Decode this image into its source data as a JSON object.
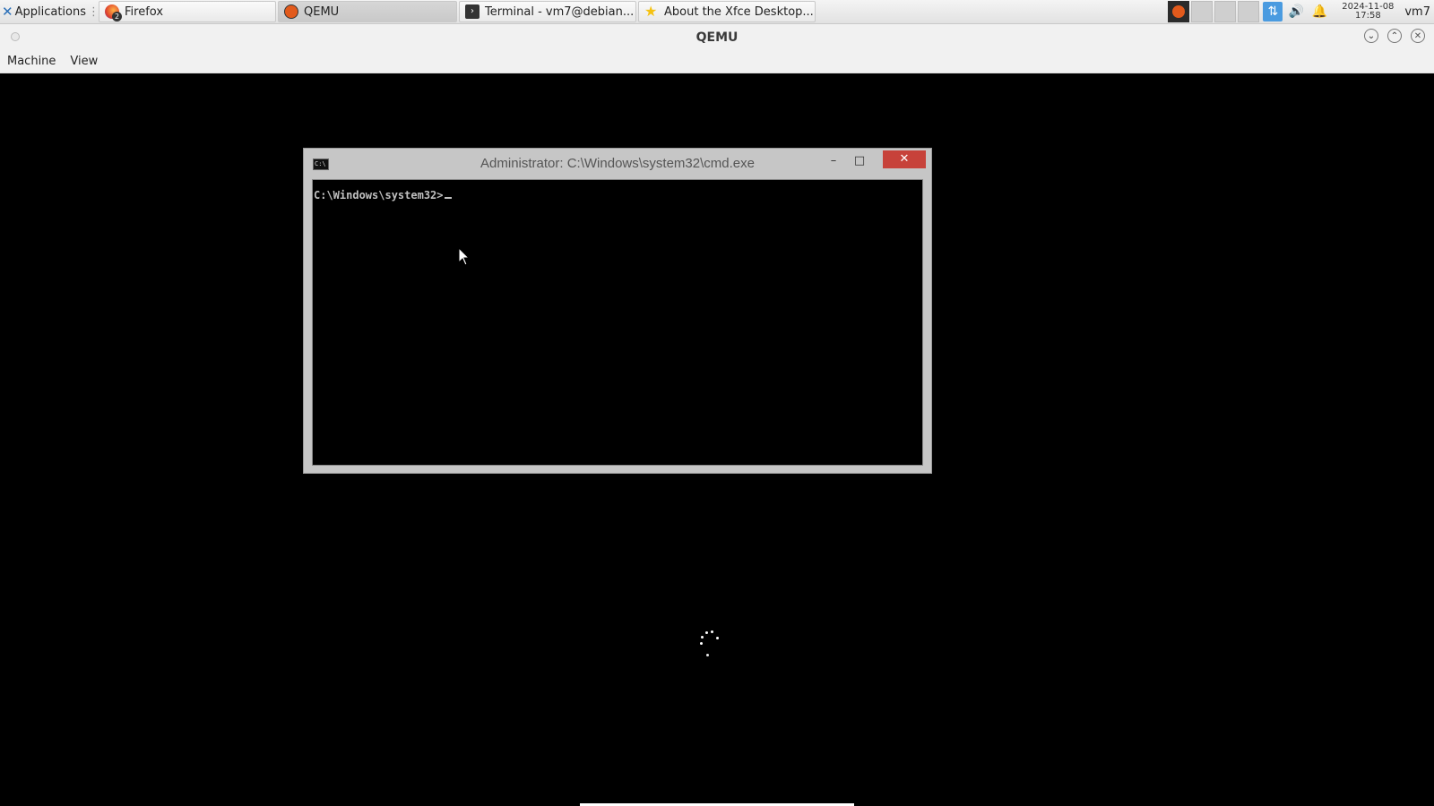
{
  "panel": {
    "app_menu_label": "Applications",
    "tasks": [
      {
        "label": "Firefox",
        "badge": "2"
      },
      {
        "label": "QEMU"
      },
      {
        "label": "Terminal - vm7@debian..."
      },
      {
        "label": "About the Xfce Desktop..."
      }
    ],
    "clock": {
      "date": "2024-11-08",
      "time": "17:58"
    },
    "user": "vm7"
  },
  "window": {
    "title": "QEMU",
    "menu": [
      "Machine",
      "View"
    ]
  },
  "cmd": {
    "title": "Administrator: C:\\Windows\\system32\\cmd.exe",
    "icon_text": "C:\\",
    "prompt": "C:\\Windows\\system32>",
    "minimize_glyph": "–",
    "maximize_glyph": "□",
    "close_glyph": "✕"
  },
  "icons": {
    "app_menu": "xfce-mouse-icon",
    "firefox": "firefox-icon",
    "qemu": "qemu-icon",
    "terminal": "terminal-icon",
    "about": "star-icon",
    "network": "network-icon",
    "volume": "volume-icon",
    "notification": "bell-icon"
  },
  "colors": {
    "cmd_close": "#c7423a",
    "vm_background": "#000000",
    "prompt_text": "#c0c0c0"
  }
}
